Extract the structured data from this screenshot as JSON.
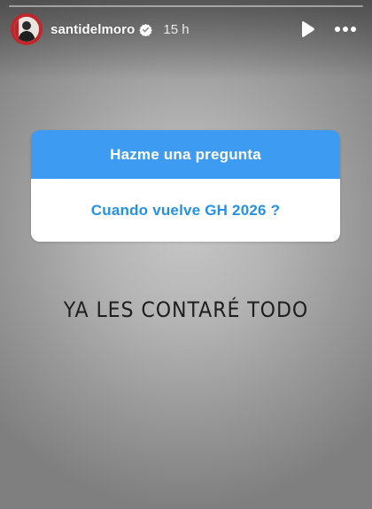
{
  "story": {
    "progress": 0.0,
    "user": {
      "username": "santidelmoro",
      "verified": true,
      "time_ago": "15 h"
    },
    "controls": {
      "play_icon": "play-icon",
      "more_icon": "more-options-icon"
    },
    "question_sticker": {
      "header": "Hazme una pregunta",
      "question": "Cuando vuelve GH 2026 ?",
      "header_color": "#3d9bf2",
      "text_color": "#2591e6"
    },
    "caption": "YA LES CONTARÉ TODO"
  }
}
